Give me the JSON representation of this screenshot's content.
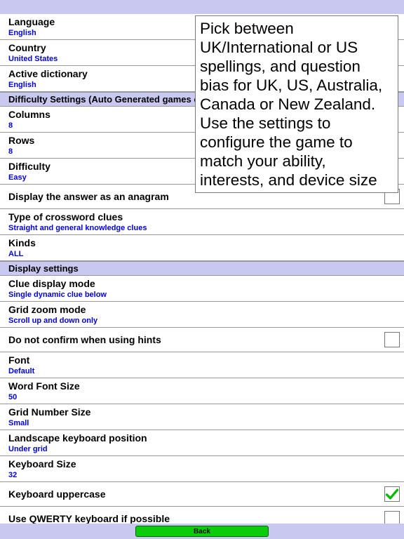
{
  "tooltip": "Pick between UK/International or US spellings, and question bias for UK, US, Australia, Canada or New Zealand. Use the settings to configure the game to match your ability, interests, and device size",
  "rows": {
    "language": {
      "label": "Language",
      "value": "English"
    },
    "country": {
      "label": "Country",
      "value": "United States"
    },
    "dictionary": {
      "label": "Active dictionary",
      "value": "English"
    },
    "section_difficulty": "Difficulty Settings (Auto Generated games only)",
    "columns": {
      "label": "Columns",
      "value": "8"
    },
    "rows_setting": {
      "label": "Rows",
      "value": "8"
    },
    "difficulty": {
      "label": "Difficulty",
      "value": "Easy"
    },
    "anagram": {
      "label": "Display the answer as an anagram"
    },
    "cluetype": {
      "label": "Type of crossword clues",
      "value": "Straight and general knowledge clues"
    },
    "kinds": {
      "label": "Kinds",
      "value": "ALL"
    },
    "section_display": "Display settings",
    "cluemode": {
      "label": "Clue display mode",
      "value": "Single dynamic clue below"
    },
    "gridzoom": {
      "label": "Grid zoom mode",
      "value": "Scroll up and down only"
    },
    "noconfirm": {
      "label": "Do not confirm when using hints"
    },
    "font": {
      "label": "Font",
      "value": "Default"
    },
    "wordfont": {
      "label": "Word Font Size",
      "value": "50"
    },
    "gridnum": {
      "label": "Grid Number Size",
      "value": "Small"
    },
    "kbpos": {
      "label": "Landscape keyboard position",
      "value": "Under grid"
    },
    "kbsize": {
      "label": "Keyboard Size",
      "value": "32"
    },
    "kbupper": {
      "label": "Keyboard uppercase"
    },
    "qwerty": {
      "label": "Use QWERTY keyboard if possible"
    }
  },
  "back": "Back"
}
